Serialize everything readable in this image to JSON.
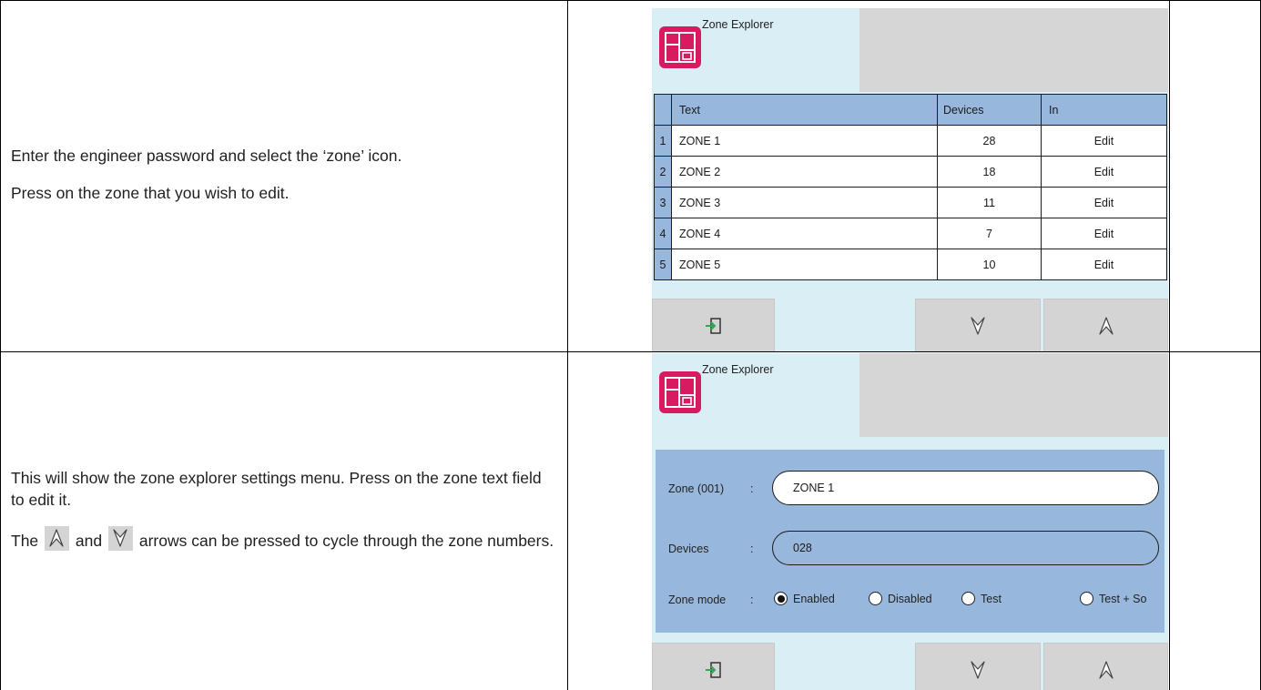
{
  "row1": {
    "instructions": [
      "Enter the engineer password and select the ‘zone’ icon.",
      "Press on the zone that you wish to edit."
    ],
    "panel": {
      "title": "Zone Explorer",
      "table": {
        "headers": [
          "Text",
          "Devices",
          "In"
        ],
        "rows": [
          {
            "index": "1",
            "text": "ZONE 1",
            "devices": "28",
            "action": "Edit"
          },
          {
            "index": "2",
            "text": "ZONE 2",
            "devices": "18",
            "action": "Edit"
          },
          {
            "index": "3",
            "text": "ZONE 3",
            "devices": "11",
            "action": "Edit"
          },
          {
            "index": "4",
            "text": "ZONE 4",
            "devices": "7",
            "action": "Edit"
          },
          {
            "index": "5",
            "text": "ZONE 5",
            "devices": "10",
            "action": "Edit"
          }
        ]
      },
      "buttons": {
        "exit": "exit-icon",
        "down": "down-arrow-icon",
        "up": "up-arrow-icon"
      }
    }
  },
  "row2": {
    "instructions": {
      "p1": "This will show the zone explorer settings menu. Press on the zone text field to edit it.",
      "p2_before": "The",
      "p2_and": "and",
      "p2_after": "arrows can be pressed to cycle through the zone numbers."
    },
    "panel": {
      "title": "Zone Explorer",
      "form": {
        "zone_label": "Zone (001)",
        "zone_value": "ZONE 1",
        "devices_label": "Devices",
        "devices_value": "028",
        "mode_label": "Zone mode",
        "separator": ":",
        "modes": [
          "Enabled",
          "Disabled",
          "Test",
          "Test + So"
        ],
        "selected_mode": "Enabled"
      },
      "buttons": {
        "exit": "exit-icon",
        "down": "down-arrow-icon",
        "up": "up-arrow-icon"
      }
    }
  },
  "colors": {
    "panel_bg": "#daeef5",
    "header_blue": "#98b7dc",
    "button_gray": "#d4d4d4",
    "logo_pink": "#d81b60",
    "exit_green": "#2fa84f"
  }
}
